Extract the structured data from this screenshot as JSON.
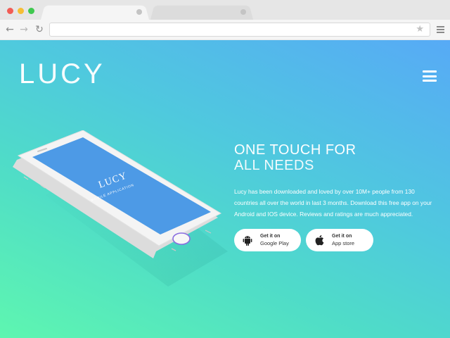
{
  "browser": {
    "tabs": [
      {
        "label": "",
        "active": true
      },
      {
        "label": "",
        "active": false
      }
    ],
    "address_bar": {
      "value": "",
      "placeholder": ""
    },
    "icons": [
      "back-icon",
      "forward-icon",
      "reload-icon",
      "star-icon",
      "menu-icon"
    ]
  },
  "header": {
    "logo_first": "L",
    "logo_rest": "UCY",
    "menu_icon": "hamburger-icon"
  },
  "phone": {
    "screen_title": "LUCY",
    "screen_subtitle": "MOBILE APPLICATION"
  },
  "hero": {
    "headline_line1": "ONE TOUCH FOR",
    "headline_line2": "ALL NEEDS",
    "description": "Lucy has been downloaded and loved by over 10M+ people from 130 countries all over the world in last 3 months. Download this free app on your Android and IOS device. Reviews and ratings are much appreciated."
  },
  "store_buttons": {
    "google": {
      "small": "Get it on",
      "big": "Google Play",
      "icon": "android-icon"
    },
    "apple": {
      "small": "Get it on",
      "big": "App store",
      "icon": "apple-icon"
    }
  },
  "colors": {
    "gradient_start": "#5ef6b0",
    "gradient_mid": "#4fc9de",
    "gradient_end": "#57aaf6",
    "phone_screen": "#4d9ae6",
    "home_ring": "#8a6ee0"
  }
}
